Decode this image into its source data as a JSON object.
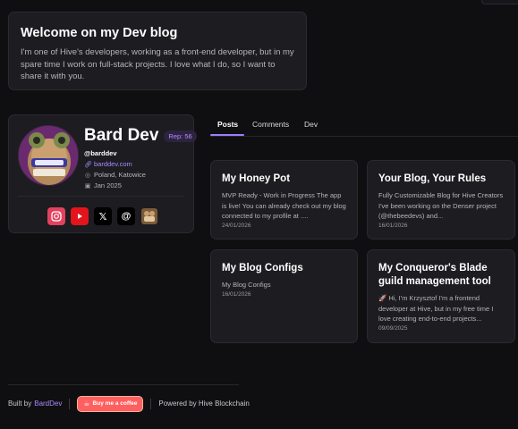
{
  "welcome": {
    "title": "Welcome on my Dev blog",
    "text": "I'm one of Hive's developers, working as a front-end developer, but in my spare time I work on full-stack projects. I love what I do, so I want to share it with you."
  },
  "profile": {
    "name": "Bard Dev",
    "rep": "Rep: 56",
    "handle": "@barddev",
    "website": "barddev.com",
    "location": "Poland, Katowice",
    "joined": "Jan 2025",
    "socials": [
      {
        "name": "instagram-icon",
        "color": "#e4405f"
      },
      {
        "name": "youtube-icon",
        "color": "#e3141b"
      },
      {
        "name": "x-icon",
        "color": "#000000"
      },
      {
        "name": "threads-icon",
        "color": "#000000"
      },
      {
        "name": "hive-profile-icon",
        "color": "#8a6a4a"
      }
    ]
  },
  "tabs": [
    "Posts",
    "Comments",
    "Dev"
  ],
  "posts": [
    {
      "title": "My Honey Pot",
      "excerpt": "MVP Ready - Work in Progress The app is live! You can already check out my blog connected to my profile at ....",
      "date": "24/01/2026"
    },
    {
      "title": "Your Blog, Your Rules",
      "excerpt": "Fully Customizable Blog for Hive Creators I've been working on the Denser project (@thebeedevs) and...",
      "date": "16/01/2026"
    },
    {
      "title": "My Blog Configs",
      "excerpt": "My Blog Configs",
      "date": "16/01/2026"
    },
    {
      "title": "My Conqueror's Blade guild management tool",
      "excerpt": "🚀 Hi, I'm Krzysztof I'm a frontend developer at Hive, but in my free time I love creating end-to-end projects...",
      "date": "09/09/2025"
    }
  ],
  "footer": {
    "built_by": "Built by",
    "brand": "BardDev",
    "coffee": "Buy me a coffee",
    "powered": "Powered by Hive Blockchain"
  },
  "colors": {
    "background": "#0f0f12",
    "card": "#1c1c21",
    "accent": "#a07cff"
  }
}
